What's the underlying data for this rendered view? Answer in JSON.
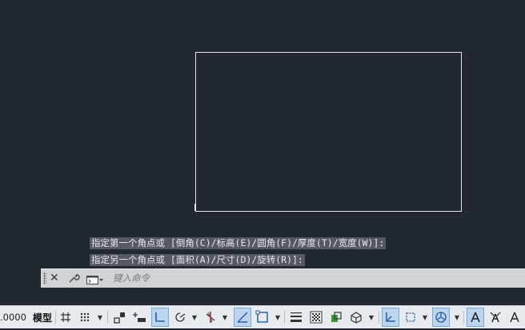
{
  "command_history": [
    "指定第一个角点或 [倒角(C)/标高(E)/圆角(F)/厚度(T)/宽度(W)]:",
    "指定另一个角点或 [面积(A)/尺寸(D)/旋转(R)]:"
  ],
  "command_line": {
    "placeholder": "键入命令",
    "value": ""
  },
  "status_bar": {
    "coordinates": ".0000",
    "model_label": "模型"
  },
  "colors": {
    "canvas_background": "#212830",
    "drawing_line": "#e6e6e6",
    "statusbar_background": "#e7eaee",
    "active_toggle": "#bcd4ee",
    "icon_blue": "#1f5fa8"
  },
  "icons": {
    "cmd_close": "close-icon",
    "cmd_customize": "wrench-icon",
    "cmd_prompt": "command-prompt-icon",
    "grid": "grid-icon",
    "snap": "snap-mode-icon",
    "infer": "infer-constraints-icon",
    "dynamic_input": "dynamic-input-icon",
    "ortho": "ortho-mode-icon",
    "polar": "polar-tracking-icon",
    "isodraft": "isometric-drafting-icon",
    "osnap_tracking": "object-snap-tracking-icon",
    "osnap": "object-snap-icon",
    "lineweight": "lineweight-icon",
    "transparency": "transparency-icon",
    "selection_cycling": "selection-cycling-icon",
    "3d_osnap": "3d-object-snap-icon",
    "ducs": "dynamic-ucs-icon",
    "selection_filter": "selection-filter-icon",
    "gizmo": "gizmo-icon",
    "annotation_visibility": "annotation-visibility-icon",
    "autoscale": "autoscale-icon",
    "annotation_scale": "annotation-scale-icon"
  }
}
